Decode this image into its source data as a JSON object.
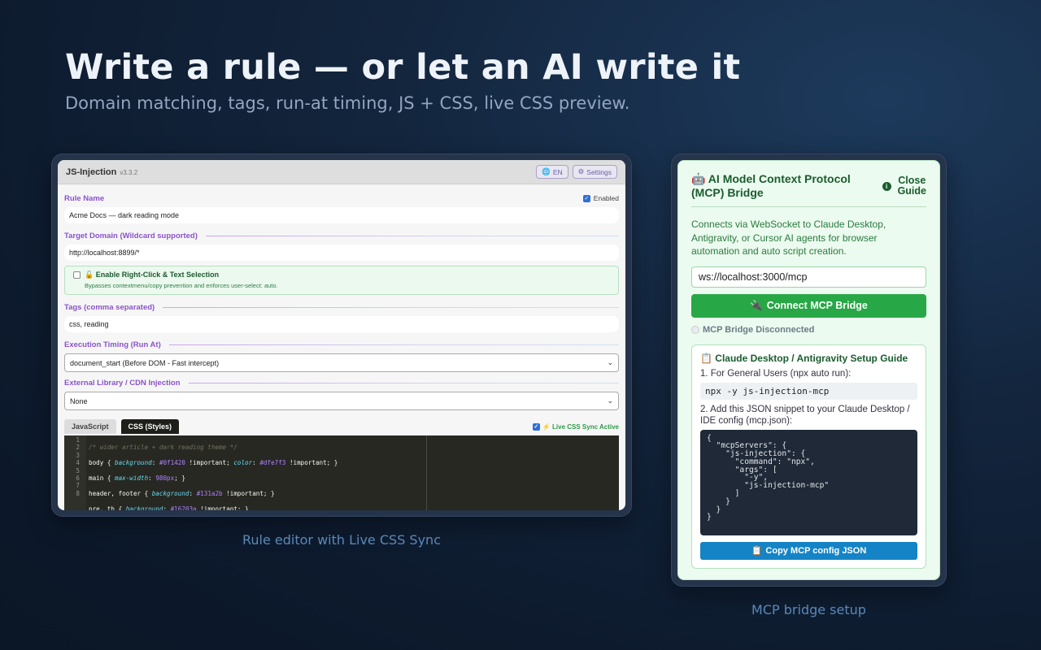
{
  "hero": {
    "title": "Write a rule — or let an AI write it",
    "subtitle": "Domain matching, tags, run-at timing, JS + CSS, live CSS preview."
  },
  "editor": {
    "app_title": "JS-Injection",
    "version": "v3.3.2",
    "lang_button": "EN",
    "settings_button": "Settings",
    "rule_name_label": "Rule Name",
    "enabled_label": "Enabled",
    "enabled_checked": true,
    "rule_name_value": "Acme Docs — dark reading mode",
    "domain_label": "Target Domain (Wildcard supported)",
    "domain_value": "http://localhost:8899/*",
    "right_click": {
      "title": "🔓 Enable Right-Click & Text Selection",
      "description": "Bypasses contextmenu/copy prevention and enforces user-select: auto.",
      "checked": false
    },
    "tags_label": "Tags (comma separated)",
    "tags_value": "css, reading",
    "timing_label": "Execution Timing (Run At)",
    "timing_value": "document_start (Before DOM - Fast intercept)",
    "library_label": "External Library / CDN Injection",
    "library_value": "None",
    "tab_js": "JavaScript",
    "tab_css": "CSS (Styles)",
    "live_sync_label": "⚡ Live CSS Sync Active",
    "live_sync_checked": true,
    "code_line_numbers": [
      "1",
      "2",
      "3",
      "4",
      "5",
      "6",
      "7",
      "8"
    ]
  },
  "caption_left": "Rule editor with Live CSS Sync",
  "mcp": {
    "title": "🤖 AI Model Context Protocol (MCP) Bridge",
    "close_line1": "Close",
    "close_line2": "Guide",
    "description": "Connects via WebSocket to Claude Desktop, Antigravity, or Cursor AI agents for browser automation and auto script creation.",
    "ws_value": "ws://localhost:3000/mcp",
    "connect_button": "Connect MCP Bridge",
    "status": "MCP Bridge Disconnected",
    "guide_title": "📋 Claude Desktop / Antigravity Setup Guide",
    "step1": "1. For General Users (npx auto run):",
    "npx_command": "npx -y js-injection-mcp",
    "step2": "2. Add this JSON snippet to your Claude Desktop / IDE config (mcp.json):",
    "json_snippet": "{\n  \"mcpServers\": {\n    \"js-injection\": {\n      \"command\": \"npx\",\n      \"args\": [\n        \"-y\",\n        \"js-injection-mcp\"\n      ]\n    }\n  }\n}",
    "copy_button": "Copy MCP config JSON"
  },
  "caption_right": "MCP bridge setup",
  "colors": {
    "accent_purple": "#8a54c8",
    "connect_green": "#27a745",
    "copy_blue": "#1484c6"
  }
}
